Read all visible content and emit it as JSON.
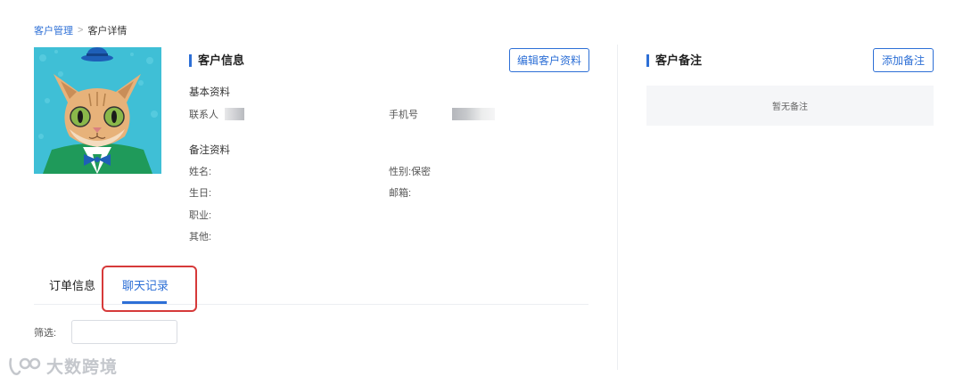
{
  "breadcrumb": {
    "parent": "客户管理",
    "separator": ">",
    "current": "客户详情"
  },
  "customer_info": {
    "title": "客户信息",
    "edit_button": "编辑客户资料",
    "basic_section": "基本资料",
    "contact_label": "联系人",
    "phone_label": "手机号",
    "notes_section": "备注资料",
    "name_label": "姓名:",
    "gender_label": "性别:",
    "gender_value": "保密",
    "birthday_label": "生日:",
    "email_label": "邮箱:",
    "job_label": "职业:",
    "other_label": "其他:"
  },
  "remarks": {
    "title": "客户备注",
    "add_button": "添加备注",
    "empty_text": "暂无备注"
  },
  "tabs": [
    {
      "label": "订单信息",
      "active": false
    },
    {
      "label": "聊天记录",
      "active": true
    }
  ],
  "filter": {
    "label": "筛选:",
    "value": ""
  },
  "watermark": "大数跨境",
  "colors": {
    "accent": "#2d6fd6",
    "highlight": "#d63a3a"
  }
}
